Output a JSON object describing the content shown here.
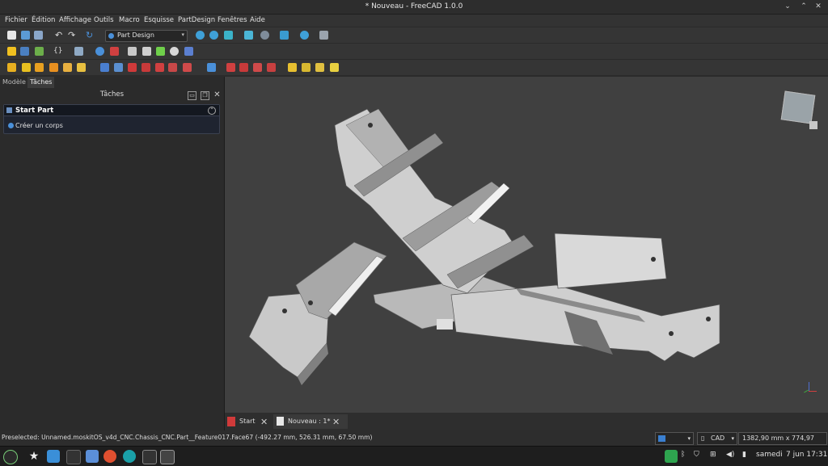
{
  "window": {
    "title": "* Nouveau - FreeCAD 1.0.0"
  },
  "menu": [
    "Fichier",
    "Édition",
    "Affichage",
    "Outils",
    "Macro",
    "Esquisse",
    "PartDesign",
    "Fenêtres",
    "Aide"
  ],
  "toolbar": {
    "workbench": "Part Design"
  },
  "combo_view": {
    "tabs": [
      "Modèle",
      "Tâches"
    ],
    "title": "Tâches",
    "task_header": "Start Part",
    "task_item": "Créer un corps"
  },
  "doc_tabs": [
    "Start",
    "Nouveau : 1*"
  ],
  "status": {
    "message": "Preselected: Unnamed.moskitOS_v4d_CNC.Chassis_CNC.Part__Feature017.Face67 (-492.27 mm, 526.31 mm, 67.50 mm)",
    "nav_style": "CAD",
    "dimensions": "1382,90 mm x 774,97 mm"
  },
  "taskbar": {
    "day": "samedi",
    "datetime": "7 jun 17:31"
  },
  "colors": {
    "accent": "#4a90d9",
    "viewport_bg": "#404040",
    "part_light": "#d9d9d9",
    "part_mid": "#9a9a9a",
    "part_dark": "#6e6e6e"
  }
}
